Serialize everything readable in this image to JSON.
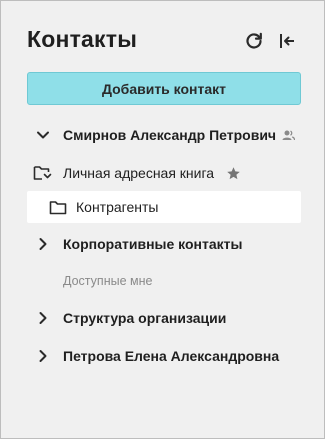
{
  "header": {
    "title": "Контакты"
  },
  "actions": {
    "add_contact_label": "Добавить контакт"
  },
  "tree": {
    "user_node": {
      "label": "Смирнов Александр Петрович"
    },
    "personal_book": {
      "label": "Личная адресная книга"
    },
    "counterparties": {
      "label": "Контрагенты"
    },
    "corporate": {
      "label": "Корпоративные контакты"
    },
    "available_section": {
      "label": "Доступные мне"
    },
    "org_structure": {
      "label": "Структура организации"
    },
    "petrova": {
      "label": "Петрова Елена Александровна"
    }
  },
  "icons": {
    "refresh": "refresh-icon",
    "collapse": "collapse-panel-icon",
    "expand": "chevron-right-icon",
    "collapse_node": "chevron-down-icon",
    "folder": "folder-icon",
    "folder_open": "folder-open-icon",
    "star": "star-icon",
    "user": "user-icon"
  },
  "colors": {
    "panel_bg": "#f0f0f0",
    "accent_button": "#8fdfe8",
    "selected_row": "#ffffff",
    "muted_text": "#8a8a8a"
  }
}
